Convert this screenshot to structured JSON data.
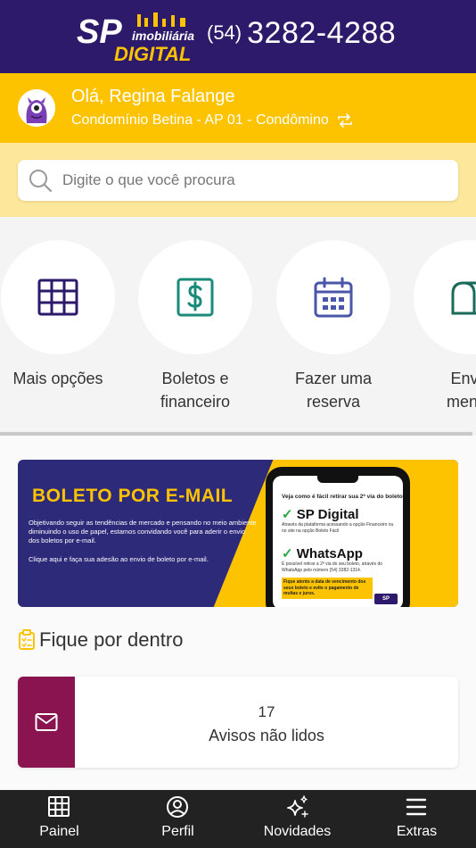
{
  "header": {
    "logo": {
      "primary": "SP",
      "secondary": "imobiliária",
      "tertiary": "DIGITAL"
    },
    "phone_ddd": "(54)",
    "phone_number": "3282-4288",
    "background_color": "#2e1a6b"
  },
  "user": {
    "greeting": "Olá, Regina Falange",
    "condominium": "Condomínio Betina - AP 01 - Condômino",
    "avatar_icon": "monster-avatar-icon",
    "accent_color": "#fdc300"
  },
  "search": {
    "placeholder": "Digite o que você procura",
    "value": ""
  },
  "shortcuts": [
    {
      "label": "Mais opções",
      "icon": "grid-icon",
      "color": "#2e1a6b"
    },
    {
      "label": "Boletos e\nfinanceiro",
      "icon": "dollar-document-icon",
      "color": "#1a8a7a"
    },
    {
      "label": "Fazer uma\nreserva",
      "icon": "calendar-icon",
      "color": "#4a56a8"
    },
    {
      "label": "Envie\nmensa",
      "icon": "mailbox-icon",
      "color": "#1a6a5a"
    }
  ],
  "banner": {
    "title": "BOLETO POR E-MAIL",
    "text": "Objetivando seguir as tendências de mercado e pensando no meio ambiente diminuindo o uso de papel, estamos convidando você para aderir o envio dos boletos por e-mail.",
    "cta": "Clique aqui e faça sua adesão ao envio de boleto por e-mail.",
    "phone_screen": {
      "heading": "Veja como é fácil retirar sua 2ª via do boleto.",
      "option1_title": "SP Digital",
      "option1_text": "Através da plataforma acessando a opção Financeiro ou no site na opção Boleto Fácil",
      "option2_title": "WhatsApp",
      "option2_text": "É possível retirar a 2ª via do seu boleto, através do WhatsApp pelo número (54) 3282-1314.",
      "note": "Fique atento a data de vencimento dos seus boleto e evite o pagamento de multas e juros.",
      "logo": "SP"
    }
  },
  "section": {
    "title": "Fique por dentro",
    "icon": "clipboard-list-icon"
  },
  "notices": {
    "count": "17",
    "label": "Avisos não lidos",
    "color": "#8a1450"
  },
  "bottom_nav": [
    {
      "label": "Painel",
      "icon": "grid-icon"
    },
    {
      "label": "Perfil",
      "icon": "user-circle-icon"
    },
    {
      "label": "Novidades",
      "icon": "sparkles-icon"
    },
    {
      "label": "Extras",
      "icon": "menu-icon"
    }
  ]
}
